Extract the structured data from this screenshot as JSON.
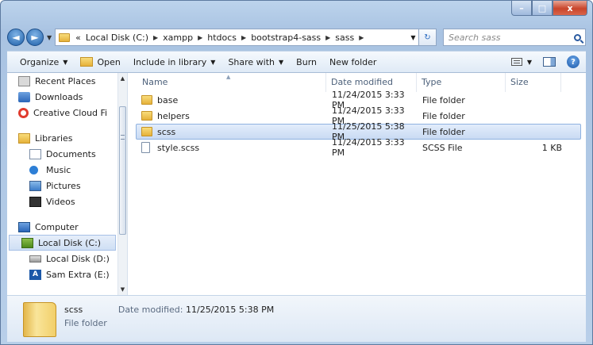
{
  "window": {
    "caption_buttons": {
      "minimize": "–",
      "maximize": "□",
      "close": "x"
    }
  },
  "address": {
    "back": "◄",
    "forward": "►",
    "overflow": "«",
    "crumbs": [
      "Local Disk (C:)",
      "xampp",
      "htdocs",
      "bootstrap4-sass",
      "sass"
    ],
    "search_placeholder": "Search sass"
  },
  "toolbar": {
    "organize": "Organize",
    "open": "Open",
    "include_in_library": "Include in library",
    "share_with": "Share with",
    "burn": "Burn",
    "new_folder": "New folder"
  },
  "nav": {
    "items": [
      {
        "label": "Recent Places",
        "icon": "recent-places-icon"
      },
      {
        "label": "Downloads",
        "icon": "downloads-icon"
      },
      {
        "label": "Creative Cloud Fi",
        "icon": "creative-cloud-icon"
      },
      {
        "label": "Libraries",
        "icon": "libraries-icon"
      },
      {
        "label": "Documents",
        "icon": "documents-icon"
      },
      {
        "label": "Music",
        "icon": "music-icon"
      },
      {
        "label": "Pictures",
        "icon": "pictures-icon"
      },
      {
        "label": "Videos",
        "icon": "videos-icon"
      },
      {
        "label": "Computer",
        "icon": "computer-icon"
      },
      {
        "label": "Local Disk (C:)",
        "icon": "local-disk-icon"
      },
      {
        "label": "Local Disk (D:)",
        "icon": "local-disk-icon"
      },
      {
        "label": "Sam Extra (E:)",
        "icon": "drive-icon"
      }
    ]
  },
  "columns": {
    "name": "Name",
    "date": "Date modified",
    "type": "Type",
    "size": "Size"
  },
  "files": [
    {
      "name": "base",
      "date": "11/24/2015 3:33 PM",
      "type": "File folder",
      "size": ""
    },
    {
      "name": "helpers",
      "date": "11/24/2015 3:33 PM",
      "type": "File folder",
      "size": ""
    },
    {
      "name": "scss",
      "date": "11/25/2015 5:38 PM",
      "type": "File folder",
      "size": ""
    },
    {
      "name": "style.scss",
      "date": "11/24/2015 3:33 PM",
      "type": "SCSS File",
      "size": "1 KB"
    }
  ],
  "details": {
    "name": "scss",
    "type": "File folder",
    "modified_label": "Date modified:",
    "modified_value": "11/25/2015 5:38 PM"
  }
}
